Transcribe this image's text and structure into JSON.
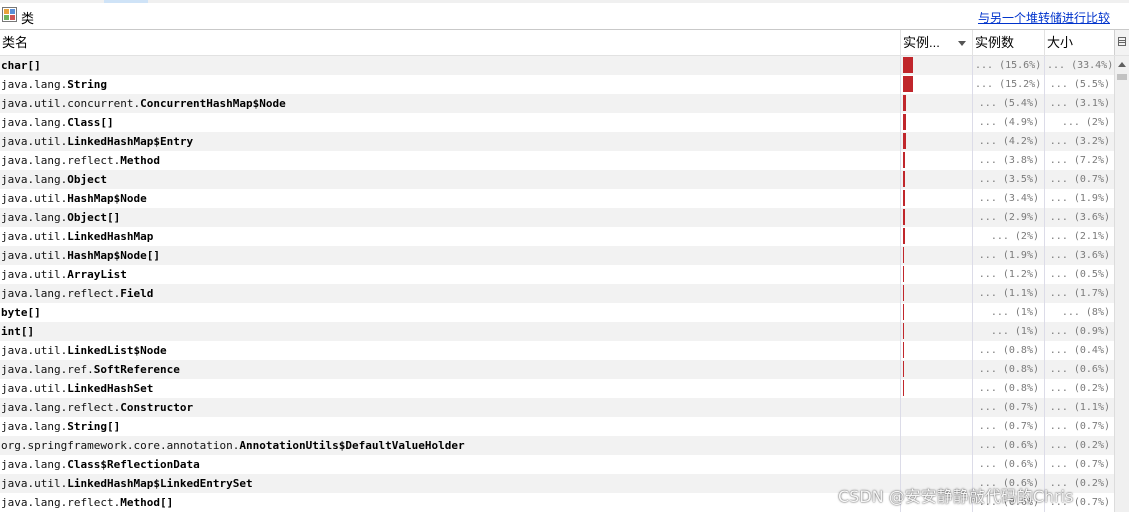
{
  "panel": {
    "title": "类",
    "compare_link": "与另一个堆转储进行比较"
  },
  "columns": {
    "name": "类名",
    "instances_pct": "实例...",
    "instances": "实例数",
    "size": "大小"
  },
  "icons": {
    "panel_icon": "class-view-icon",
    "sort": "sort-descending-icon",
    "column_menu": "column-chooser-icon",
    "scroll_up": "scroll-up-arrow-icon"
  },
  "colors": {
    "bar": "#c0262c",
    "link": "#0033cc",
    "row_alt": "#f2f2f2"
  },
  "rows": [
    {
      "pkg": "",
      "cls": "char[]",
      "pct": 15.6,
      "count": "... (15.6%)",
      "size": "... (33.4%)"
    },
    {
      "pkg": "java.lang.",
      "cls": "String",
      "pct": 15.2,
      "count": "... (15.2%)",
      "size": "... (5.5%)"
    },
    {
      "pkg": "java.util.concurrent.",
      "cls": "ConcurrentHashMap$Node",
      "pct": 5.4,
      "count": "... (5.4%)",
      "size": "... (3.1%)"
    },
    {
      "pkg": "java.lang.",
      "cls": "Class[]",
      "pct": 4.9,
      "count": "... (4.9%)",
      "size": "... (2%)"
    },
    {
      "pkg": "java.util.",
      "cls": "LinkedHashMap$Entry",
      "pct": 4.2,
      "count": "... (4.2%)",
      "size": "... (3.2%)"
    },
    {
      "pkg": "java.lang.reflect.",
      "cls": "Method",
      "pct": 3.8,
      "count": "... (3.8%)",
      "size": "... (7.2%)"
    },
    {
      "pkg": "java.lang.",
      "cls": "Object",
      "pct": 3.5,
      "count": "... (3.5%)",
      "size": "... (0.7%)"
    },
    {
      "pkg": "java.util.",
      "cls": "HashMap$Node",
      "pct": 3.4,
      "count": "... (3.4%)",
      "size": "... (1.9%)"
    },
    {
      "pkg": "java.lang.",
      "cls": "Object[]",
      "pct": 2.9,
      "count": "... (2.9%)",
      "size": "... (3.6%)"
    },
    {
      "pkg": "java.util.",
      "cls": "LinkedHashMap",
      "pct": 2.0,
      "count": "... (2%)",
      "size": "... (2.1%)"
    },
    {
      "pkg": "java.util.",
      "cls": "HashMap$Node[]",
      "pct": 1.9,
      "count": "... (1.9%)",
      "size": "... (3.6%)"
    },
    {
      "pkg": "java.util.",
      "cls": "ArrayList",
      "pct": 1.2,
      "count": "... (1.2%)",
      "size": "... (0.5%)"
    },
    {
      "pkg": "java.lang.reflect.",
      "cls": "Field",
      "pct": 1.1,
      "count": "... (1.1%)",
      "size": "... (1.7%)"
    },
    {
      "pkg": "",
      "cls": "byte[]",
      "pct": 1.0,
      "count": "... (1%)",
      "size": "... (8%)"
    },
    {
      "pkg": "",
      "cls": "int[]",
      "pct": 1.0,
      "count": "... (1%)",
      "size": "... (0.9%)"
    },
    {
      "pkg": "java.util.",
      "cls": "LinkedList$Node",
      "pct": 0.8,
      "count": "... (0.8%)",
      "size": "... (0.4%)"
    },
    {
      "pkg": "java.lang.ref.",
      "cls": "SoftReference",
      "pct": 0.8,
      "count": "... (0.8%)",
      "size": "... (0.6%)"
    },
    {
      "pkg": "java.util.",
      "cls": "LinkedHashSet",
      "pct": 0.8,
      "count": "... (0.8%)",
      "size": "... (0.2%)"
    },
    {
      "pkg": "java.lang.reflect.",
      "cls": "Constructor",
      "pct": 0.7,
      "count": "... (0.7%)",
      "size": "... (1.1%)"
    },
    {
      "pkg": "java.lang.",
      "cls": "String[]",
      "pct": 0.7,
      "count": "... (0.7%)",
      "size": "... (0.7%)"
    },
    {
      "pkg": "org.springframework.core.annotation.",
      "cls": "AnnotationUtils$DefaultValueHolder",
      "pct": 0.6,
      "count": "... (0.6%)",
      "size": "... (0.2%)"
    },
    {
      "pkg": "java.lang.",
      "cls": "Class$ReflectionData",
      "pct": 0.6,
      "count": "... (0.6%)",
      "size": "... (0.7%)"
    },
    {
      "pkg": "java.util.",
      "cls": "LinkedHashMap$LinkedEntrySet",
      "pct": 0.6,
      "count": "... (0.6%)",
      "size": "... (0.2%)"
    },
    {
      "pkg": "java.lang.reflect.",
      "cls": "Method[]",
      "pct": 0.6,
      "count": "... (0.6%)",
      "size": "... (0.7%)"
    }
  ],
  "watermark": "CSDN @安安静静敲代码的Chris"
}
